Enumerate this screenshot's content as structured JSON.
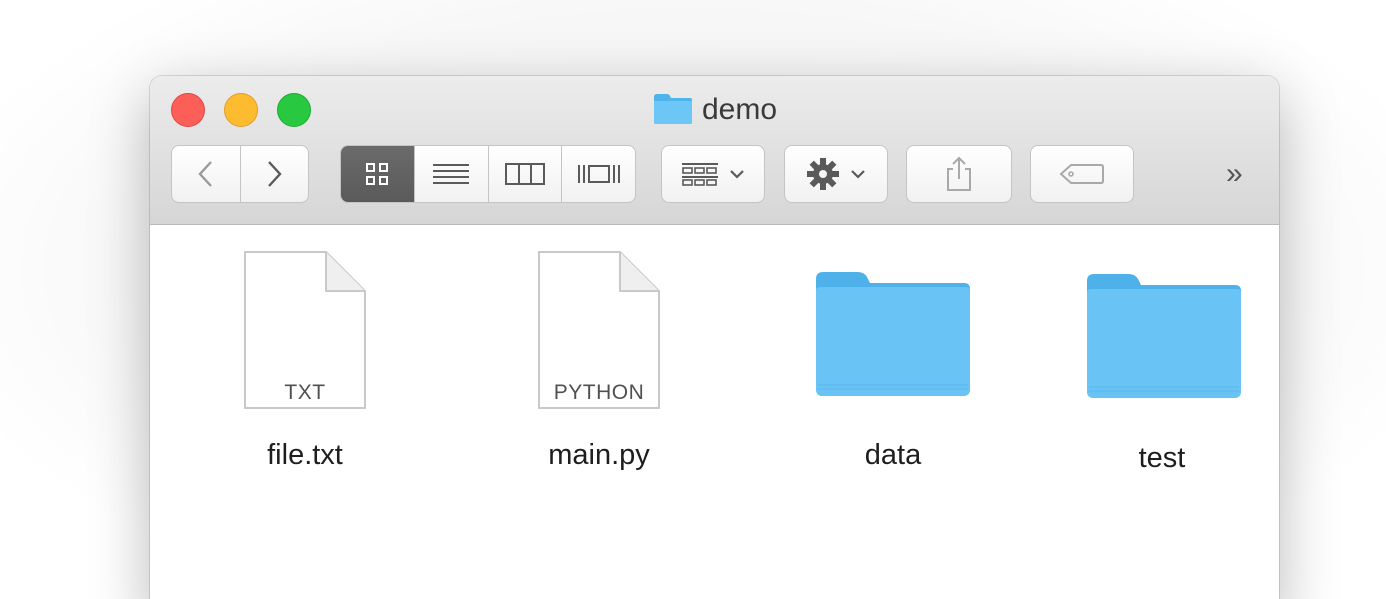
{
  "window": {
    "title": "demo",
    "title_icon": "folder-icon"
  },
  "toolbar": {
    "back_icon": "chevron-left-icon",
    "forward_icon": "chevron-right-icon",
    "view_icons": [
      "icon-view-icon",
      "list-view-icon",
      "column-view-icon",
      "cover-flow-view-icon"
    ],
    "active_view": "icon-view",
    "arrange_icon": "arrange-grid-icon",
    "action_icon": "gear-icon",
    "share_icon": "share-icon",
    "tag_icon": "tag-icon",
    "more_label": "»"
  },
  "files": [
    {
      "name": "file.txt",
      "kind": "document",
      "ext_label": "TXT"
    },
    {
      "name": "main.py",
      "kind": "document",
      "ext_label": "PYTHON"
    },
    {
      "name": "data",
      "kind": "folder"
    },
    {
      "name": "test",
      "kind": "folder"
    }
  ],
  "colors": {
    "folder_blue": "#5ec0f5",
    "close": "#fc5f57",
    "minimize": "#fdbb2f",
    "zoom": "#28c941"
  }
}
